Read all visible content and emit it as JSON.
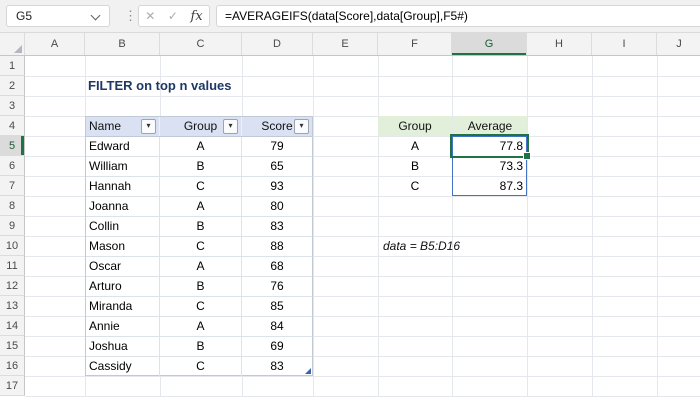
{
  "app": {
    "name_box_value": "G5",
    "formula": "=AVERAGEIFS(data[Score],data[Group],F5#)",
    "fx_label": "fx",
    "cancel_glyph": "✕",
    "enter_glyph": "✓",
    "dots_glyph": "⋮",
    "filter_arrow_glyph": "▾"
  },
  "grid": {
    "column_headers": [
      "A",
      "B",
      "C",
      "D",
      "E",
      "F",
      "G",
      "H",
      "I",
      "J"
    ],
    "row_headers": [
      "1",
      "2",
      "3",
      "4",
      "5",
      "6",
      "7",
      "8",
      "9",
      "10",
      "11",
      "12",
      "13",
      "14",
      "15",
      "16",
      "17"
    ],
    "selected_column": "G",
    "selected_row": "5",
    "active_cell": "G5"
  },
  "content": {
    "title": "FILTER on top n values",
    "annotation": "data = B5:D16",
    "data_table": {
      "headers": [
        "Name",
        "Group",
        "Score"
      ],
      "rows": [
        [
          "Edward",
          "A",
          "79"
        ],
        [
          "William",
          "B",
          "65"
        ],
        [
          "Hannah",
          "C",
          "93"
        ],
        [
          "Joanna",
          "A",
          "80"
        ],
        [
          "Collin",
          "B",
          "83"
        ],
        [
          "Mason",
          "C",
          "88"
        ],
        [
          "Oscar",
          "A",
          "68"
        ],
        [
          "Arturo",
          "B",
          "76"
        ],
        [
          "Miranda",
          "C",
          "85"
        ],
        [
          "Annie",
          "A",
          "84"
        ],
        [
          "Joshua",
          "B",
          "69"
        ],
        [
          "Cassidy",
          "C",
          "83"
        ]
      ]
    },
    "result_table": {
      "headers": [
        "Group",
        "Average"
      ],
      "rows": [
        [
          "A",
          "77.8"
        ],
        [
          "B",
          "73.3"
        ],
        [
          "C",
          "87.3"
        ]
      ]
    }
  },
  "colors": {
    "selection_green": "#1E7243",
    "spill_border_blue": "#4472C4",
    "data_table_header_fill": "#D9E1F2",
    "result_table_header_fill": "#E2EFDA",
    "title_text": "#1F3864"
  }
}
